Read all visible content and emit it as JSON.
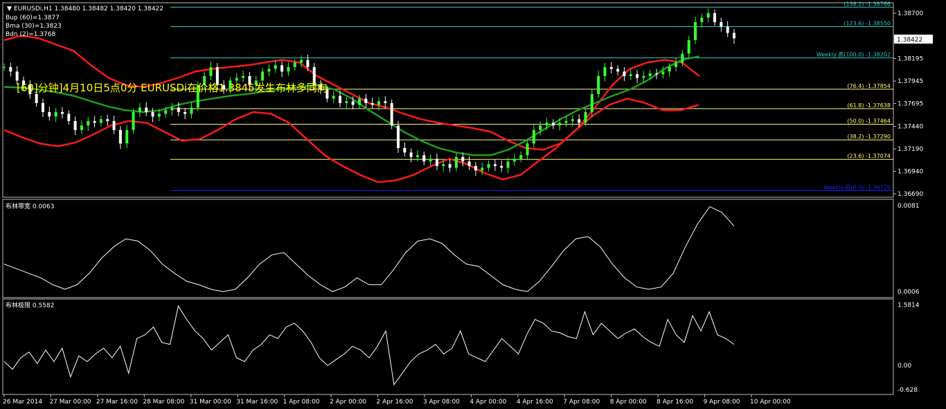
{
  "window": {
    "symbol_line": "EURUSDi,H1  1.38480 1.38482 1.38420 1.38422",
    "indicators": [
      "Bup (60)=1.3877",
      "Bma (30)=1.3823",
      "Bdn (2)=1.3768"
    ],
    "alert_text": "[60]分钟]4月10日5点0分  EURUSDi在价格1.3845发生布林多同向",
    "current_price": "1.38422"
  },
  "colors": {
    "background": "#000000",
    "grid_frame": "#c0c0c0",
    "fib": "#ffff80",
    "fib_top": "#33cccc",
    "weekly_low": "#2020ff",
    "bull_candle": "#33ff33",
    "bear_candle": "#ffffff",
    "band_outer": "#ff1a1a",
    "band_mid": "#1f9e1f",
    "indicator_line": "#ffffff",
    "alert": "#ffff00"
  },
  "chart_data": {
    "type": "line",
    "symbol": "EURUSDi",
    "timeframe": "H1",
    "main_panel": {
      "price_ticks": [
        "1.38700",
        "1.38195",
        "1.37945",
        "1.37695",
        "1.37440",
        "1.37190",
        "1.36940",
        "1.36690"
      ],
      "ylim": [
        1.3666,
        1.388
      ],
      "fib_levels": [
        {
          "label": "(138.2) -1.38766",
          "value": 1.38766,
          "style": "top"
        },
        {
          "label": "(123.6) -1.38550",
          "value": 1.3855,
          "style": "top"
        },
        {
          "label": "Weekly 高(100.0) -1.38202",
          "value": 1.38202,
          "style": "top"
        },
        {
          "label": "(76.4) -1.37854",
          "value": 1.37854,
          "style": "fib"
        },
        {
          "label": "(61.8) -1.37638",
          "value": 1.37638,
          "style": "fib"
        },
        {
          "label": "(50.0) -1.37464",
          "value": 1.37464,
          "style": "fib"
        },
        {
          "label": "(38.2) -1.37290",
          "value": 1.3729,
          "style": "fib"
        },
        {
          "label": "(23.6) -1.37074",
          "value": 1.37074,
          "style": "fib"
        },
        {
          "label": "Weekly 低(0.0) -1.36726",
          "value": 1.36726,
          "style": "weekly_low"
        }
      ],
      "close_series": [
        1.381,
        1.3805,
        1.3795,
        1.379,
        1.378,
        1.377,
        1.376,
        1.3755,
        1.376,
        1.3758,
        1.375,
        1.374,
        1.3745,
        1.375,
        1.3748,
        1.3752,
        1.375,
        1.374,
        1.3725,
        1.374,
        1.376,
        1.3765,
        1.376,
        1.3755,
        1.3758,
        1.3762,
        1.3765,
        1.376,
        1.3758,
        1.3765,
        1.379,
        1.38,
        1.381,
        1.379,
        1.3785,
        1.3795,
        1.3798,
        1.38,
        1.379,
        1.3795,
        1.3805,
        1.3808,
        1.3812,
        1.3805,
        1.381,
        1.3815,
        1.3818,
        1.381,
        1.379,
        1.3785,
        1.3775,
        1.3778,
        1.377,
        1.3772,
        1.3768,
        1.3775,
        1.377,
        1.3768,
        1.3772,
        1.377,
        1.3745,
        1.372,
        1.3715,
        1.371,
        1.3712,
        1.3705,
        1.3708,
        1.37,
        1.3702,
        1.3698,
        1.371,
        1.3705,
        1.37,
        1.3695,
        1.3698,
        1.3702,
        1.37,
        1.3698,
        1.3705,
        1.3708,
        1.3712,
        1.3725,
        1.374,
        1.3745,
        1.3748,
        1.3745,
        1.3748,
        1.375,
        1.3752,
        1.3748,
        1.376,
        1.378,
        1.38,
        1.381,
        1.3808,
        1.3805,
        1.38,
        1.3802,
        1.3798,
        1.38,
        1.3803,
        1.3802,
        1.3805,
        1.381,
        1.3815,
        1.3825,
        1.384,
        1.386,
        1.3865,
        1.387,
        1.386,
        1.3855,
        1.3848,
        1.3842
      ],
      "bands": {
        "upper": [
          1.384,
          1.3845,
          1.3842,
          1.3835,
          1.3828,
          1.3812,
          1.3798,
          1.379,
          1.3788,
          1.3792,
          1.3798,
          1.3805,
          1.3808,
          1.381,
          1.3812,
          1.3815,
          1.3818,
          1.3815,
          1.38,
          1.379,
          1.378,
          1.377,
          1.3765,
          1.3758,
          1.3752,
          1.3748,
          1.3745,
          1.3742,
          1.3738,
          1.3728,
          1.372,
          1.3718,
          1.3725,
          1.3742,
          1.3765,
          1.379,
          1.3808,
          1.3815,
          1.3818,
          1.3815,
          1.38,
          null,
          null
        ],
        "middle": [
          1.3788,
          1.3787,
          1.3785,
          1.3782,
          1.3778,
          1.3772,
          1.3766,
          1.3762,
          1.376,
          1.3762,
          1.3768,
          1.3772,
          1.3775,
          1.3778,
          1.378,
          1.3783,
          1.3786,
          1.3788,
          1.379,
          1.3785,
          1.3775,
          1.3762,
          1.375,
          1.3738,
          1.3728,
          1.372,
          1.3715,
          1.3712,
          1.3712,
          1.3718,
          1.3728,
          1.374,
          1.3752,
          1.3762,
          1.377,
          1.3778,
          1.3785,
          1.3795,
          1.3808,
          1.3818,
          1.3822,
          null,
          null
        ],
        "lower": [
          1.374,
          1.3732,
          1.3725,
          1.3722,
          1.3726,
          1.3735,
          1.3745,
          1.375,
          1.3748,
          1.3738,
          1.3728,
          1.373,
          1.374,
          1.3752,
          1.376,
          1.3758,
          1.3748,
          1.373,
          1.3712,
          1.37,
          1.369,
          1.3682,
          1.3684,
          1.369,
          1.37,
          1.3708,
          1.3702,
          1.3692,
          1.3685,
          1.369,
          1.3705,
          1.372,
          1.3738,
          1.3755,
          1.3768,
          1.3775,
          1.377,
          1.3762,
          1.3762,
          1.3768,
          null,
          null
        ]
      }
    },
    "bandwidth_panel": {
      "label": "布林带宽 0.0063",
      "ticks": [
        "0.0081",
        "0.0006"
      ],
      "ylim": [
        0.0002,
        0.0084
      ],
      "values": [
        0.003,
        0.0026,
        0.0022,
        0.0018,
        0.0012,
        0.0008,
        0.0012,
        0.0022,
        0.0035,
        0.0045,
        0.0052,
        0.005,
        0.0042,
        0.003,
        0.0022,
        0.0015,
        0.0012,
        0.0008,
        0.0006,
        0.0008,
        0.0018,
        0.003,
        0.0038,
        0.004,
        0.003,
        0.002,
        0.0012,
        0.0006,
        0.001,
        0.0018,
        0.0012,
        0.0012,
        0.0025,
        0.004,
        0.005,
        0.0052,
        0.0048,
        0.0038,
        0.003,
        0.0028,
        0.002,
        0.0012,
        0.0008,
        0.0006,
        0.0015,
        0.0028,
        0.0042,
        0.0052,
        0.0054,
        0.0045,
        0.003,
        0.0018,
        0.001,
        0.0008,
        0.001,
        0.0022,
        0.0045,
        0.0065,
        0.008,
        0.0075,
        0.0063
      ]
    },
    "extreme_panel": {
      "label": "布林极限 0.5582",
      "ticks": [
        "1.5814",
        "0.00",
        "-0.628"
      ],
      "ylim": [
        -0.72,
        1.66
      ],
      "values": [
        0.1,
        -0.1,
        0.2,
        0.35,
        0.05,
        0.4,
        0.1,
        0.45,
        -0.3,
        0.25,
        0.1,
        0.3,
        0.45,
        0.2,
        0.5,
        -0.2,
        0.7,
        0.8,
        1.0,
        0.6,
        0.55,
        1.55,
        1.2,
        0.9,
        0.7,
        0.4,
        0.6,
        0.8,
        0.2,
        0.1,
        0.4,
        0.55,
        0.8,
        0.7,
        1.0,
        1.1,
        0.9,
        0.6,
        0.2,
        0.0,
        0.15,
        0.3,
        0.5,
        0.4,
        0.2,
        0.5,
        0.9,
        -0.5,
        -0.2,
        0.1,
        0.3,
        0.4,
        0.55,
        0.3,
        0.45,
        0.9,
        0.3,
        0.2,
        0.1,
        0.4,
        0.7,
        0.5,
        0.3,
        0.8,
        1.2,
        1.1,
        0.9,
        0.85,
        0.75,
        0.7,
        1.4,
        0.8,
        1.1,
        0.9,
        0.7,
        0.85,
        0.95,
        0.75,
        0.6,
        0.5,
        1.2,
        0.8,
        0.6,
        1.3,
        0.9,
        1.4,
        0.8,
        0.7,
        0.55
      ]
    },
    "x_tick_labels": [
      "26 Mar 2014",
      "27 Mar 00:00",
      "27 Mar 16:00",
      "28 Mar 08:00",
      "31 Mar 00:00",
      "31 Mar 16:00",
      "1 Apr 08:00",
      "2 Apr 00:00",
      "2 Apr 16:00",
      "3 Apr 08:00",
      "4 Apr 00:00",
      "4 Apr 16:00",
      "7 Apr 08:00",
      "8 Apr 00:00",
      "8 Apr 16:00",
      "9 Apr 08:00",
      "10 Apr 00:00"
    ]
  }
}
